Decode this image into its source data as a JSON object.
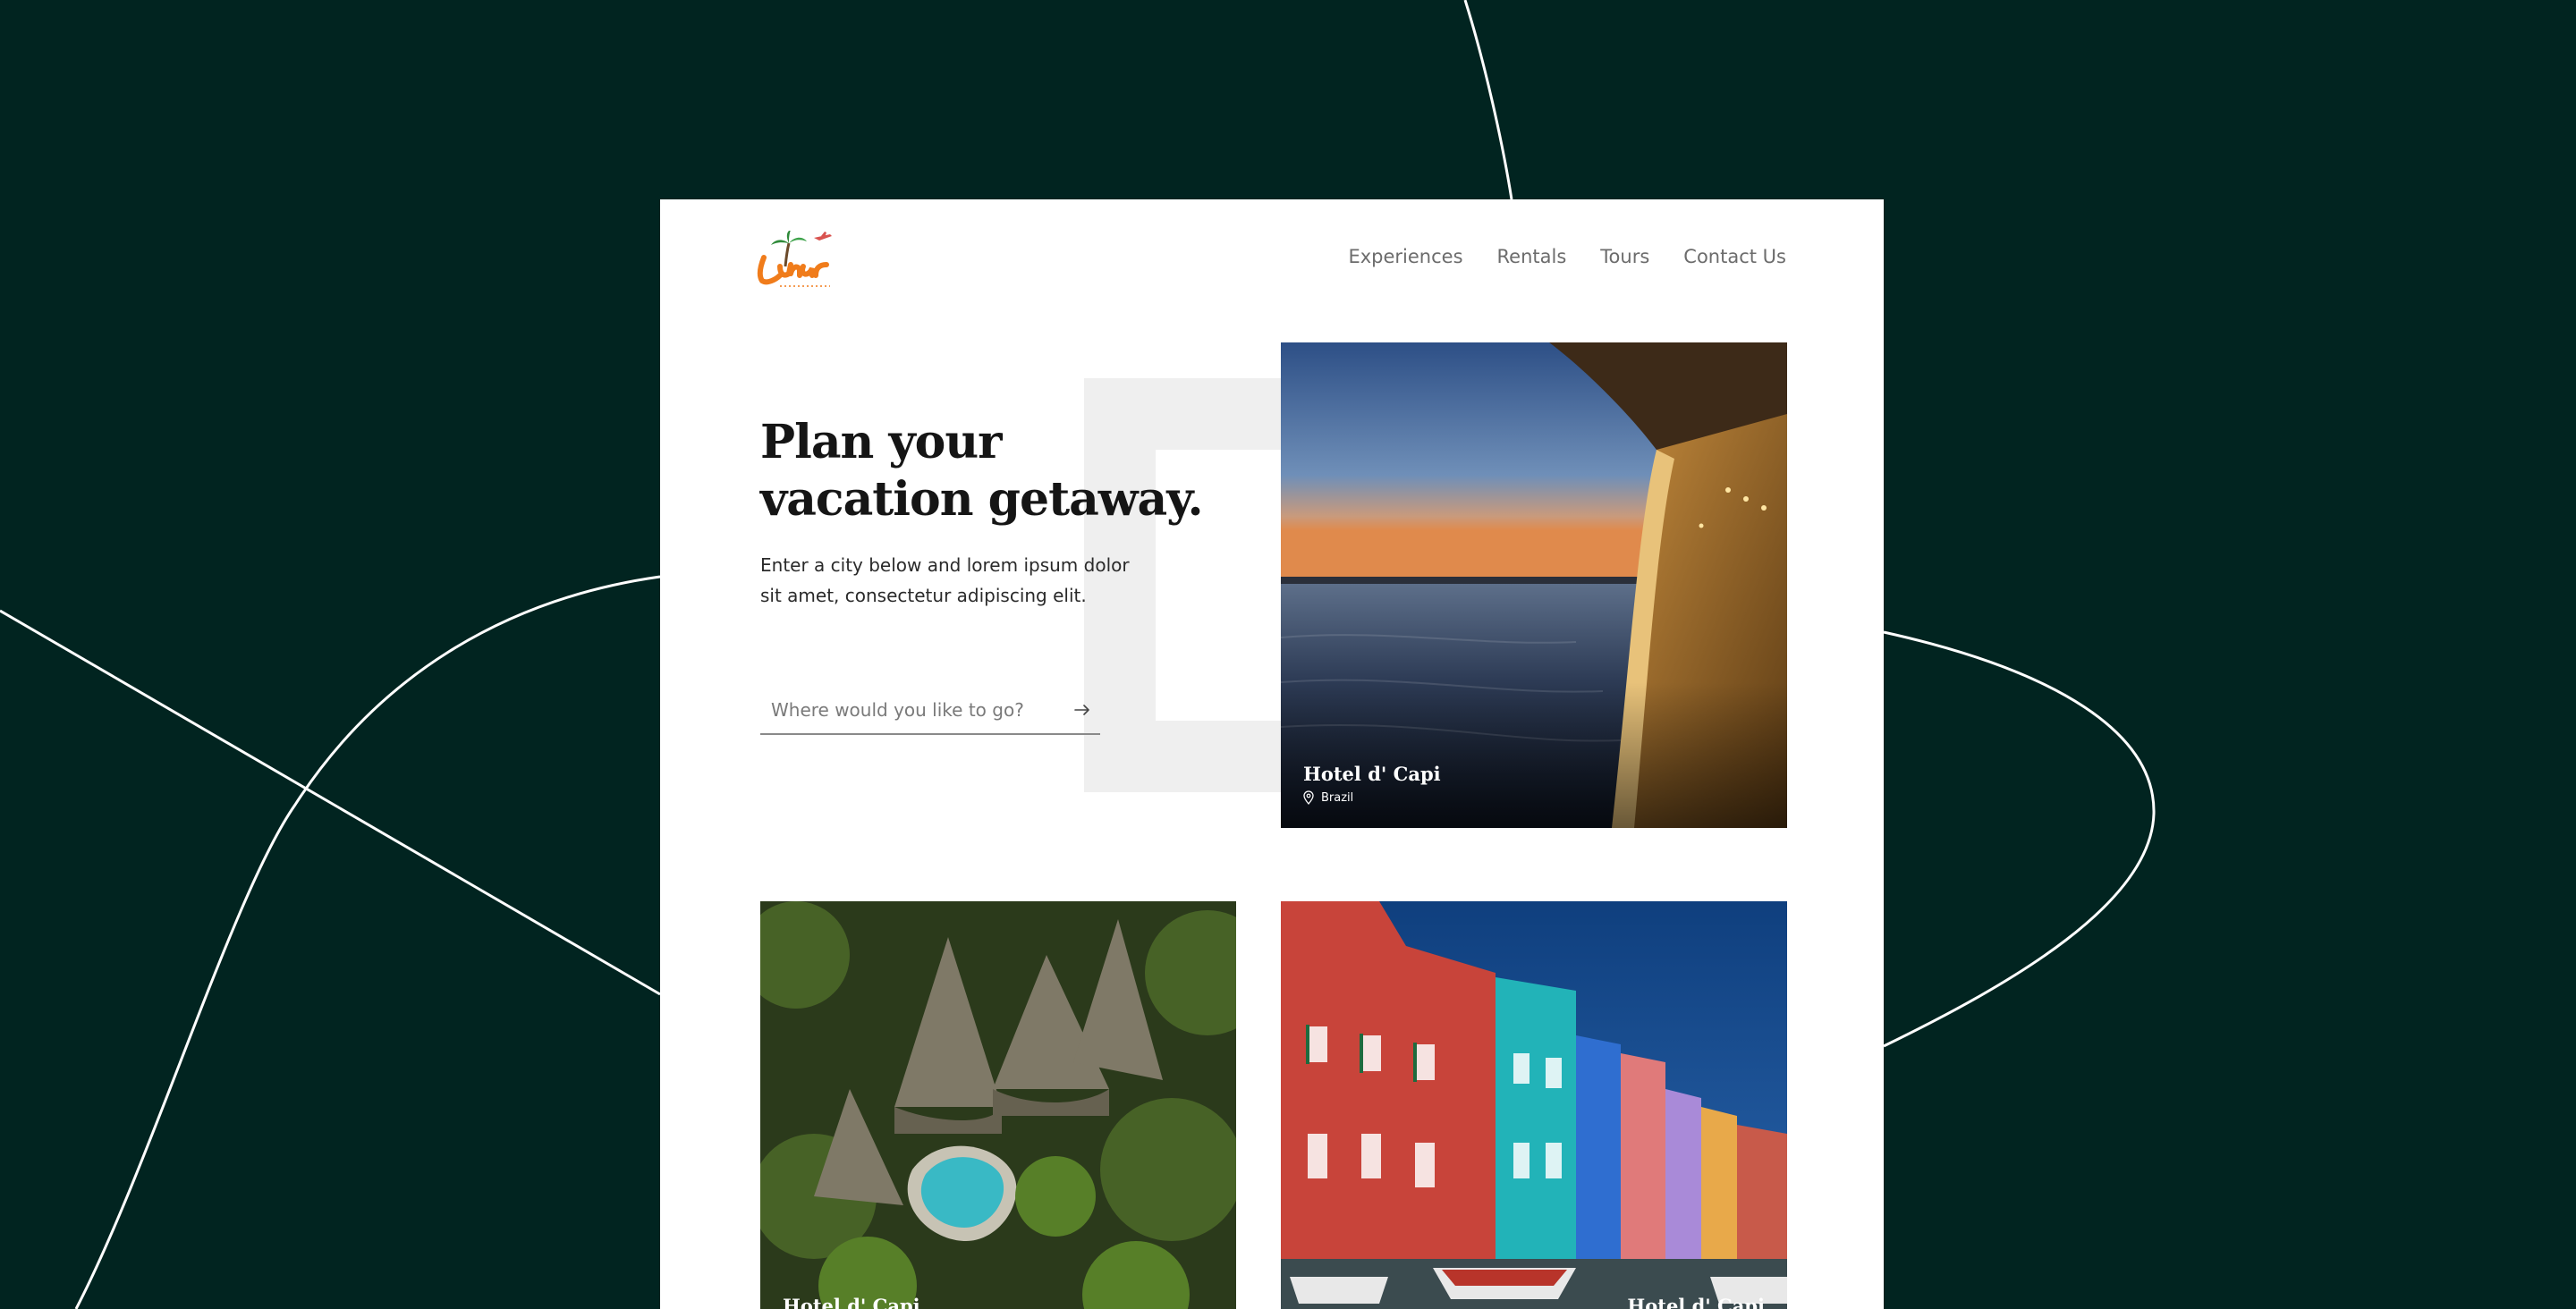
{
  "brand": {
    "name": "Lunar",
    "tagline": "TRAVEL",
    "colors": {
      "orange": "#f07c1b",
      "palm": "#2f8a3a",
      "plane": "#d9534f"
    }
  },
  "nav": {
    "items": [
      {
        "label": "Experiences"
      },
      {
        "label": "Rentals"
      },
      {
        "label": "Tours"
      },
      {
        "label": "Contact Us"
      }
    ]
  },
  "hero": {
    "title_line1": "Plan your",
    "title_line2": "vacation getaway.",
    "subtitle_line1": "Enter a city below and lorem ipsum dolor",
    "subtitle_line2": "sit amet, consectetur adipiscing elit."
  },
  "search": {
    "placeholder": "Where would you like to go?",
    "submit_icon": "arrow-right-icon"
  },
  "cards": [
    {
      "title": "Hotel d' Capi",
      "location": "Brazil",
      "icon": "map-pin-icon"
    },
    {
      "title": "Hotel d' Capi"
    },
    {
      "title": "Hotel d' Capi"
    }
  ],
  "theme": {
    "background": "#012420",
    "panel": "#ffffff",
    "text_dark": "#151515",
    "nav_text": "#6c6c6c"
  }
}
